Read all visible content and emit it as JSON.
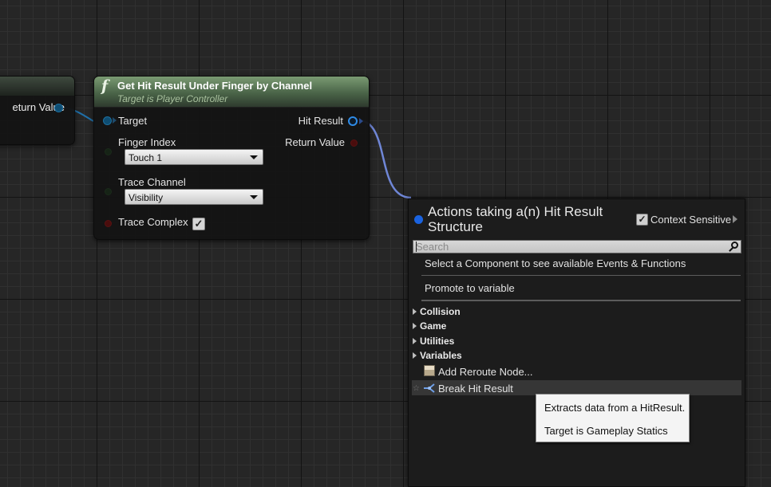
{
  "graph": {
    "left_node": {
      "pin_label": "eturn Value"
    },
    "main_node": {
      "title": "Get Hit Result Under Finger by Channel",
      "subtitle": "Target is Player Controller",
      "function_icon": "f",
      "inputs": {
        "target": "Target",
        "finger_index": "Finger Index",
        "finger_index_value": "Touch 1",
        "trace_channel": "Trace Channel",
        "trace_channel_value": "Visibility",
        "trace_complex": "Trace Complex",
        "trace_complex_checked": true
      },
      "outputs": {
        "hit_result": "Hit Result",
        "return_value": "Return Value"
      }
    }
  },
  "action_menu": {
    "title": "Actions taking a(n) Hit Result Structure",
    "context_sensitive_label": "Context Sensitive",
    "context_sensitive_checked": true,
    "search_placeholder": "Search",
    "hint": "Select a Component to see available Events & Functions",
    "promote": "Promote to variable",
    "categories": [
      "Collision",
      "Game",
      "Utilities",
      "Variables"
    ],
    "reroute": "Add Reroute Node...",
    "break_hit_result": "Break Hit Result"
  },
  "tooltip": {
    "line1": "Extracts data from a HitResult.",
    "line2": "Target is Gameplay Statics"
  },
  "colors": {
    "wire_object": "#1f6fa8",
    "wire_struct": "#6f86d6",
    "header_green": "#4a6448",
    "accent_blue": "#1a63e0"
  },
  "icons": [
    "function-icon",
    "search-icon",
    "reroute-node-icon",
    "break-struct-icon",
    "star-icon",
    "checkmark-icon"
  ]
}
